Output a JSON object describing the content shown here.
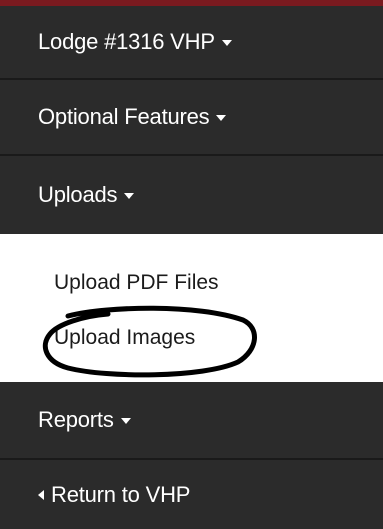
{
  "nav": {
    "lodge_label": "Lodge #1316 VHP",
    "optional_label": "Optional Features",
    "uploads_label": "Uploads",
    "reports_label": "Reports",
    "return_label": "Return to VHP"
  },
  "uploads_menu": {
    "pdf_label": "Upload PDF Files",
    "images_label": "Upload Images"
  },
  "colors": {
    "nav_bg": "#2b2b2b",
    "accent_top": "#7a1a1f",
    "annotation": "#000000"
  }
}
